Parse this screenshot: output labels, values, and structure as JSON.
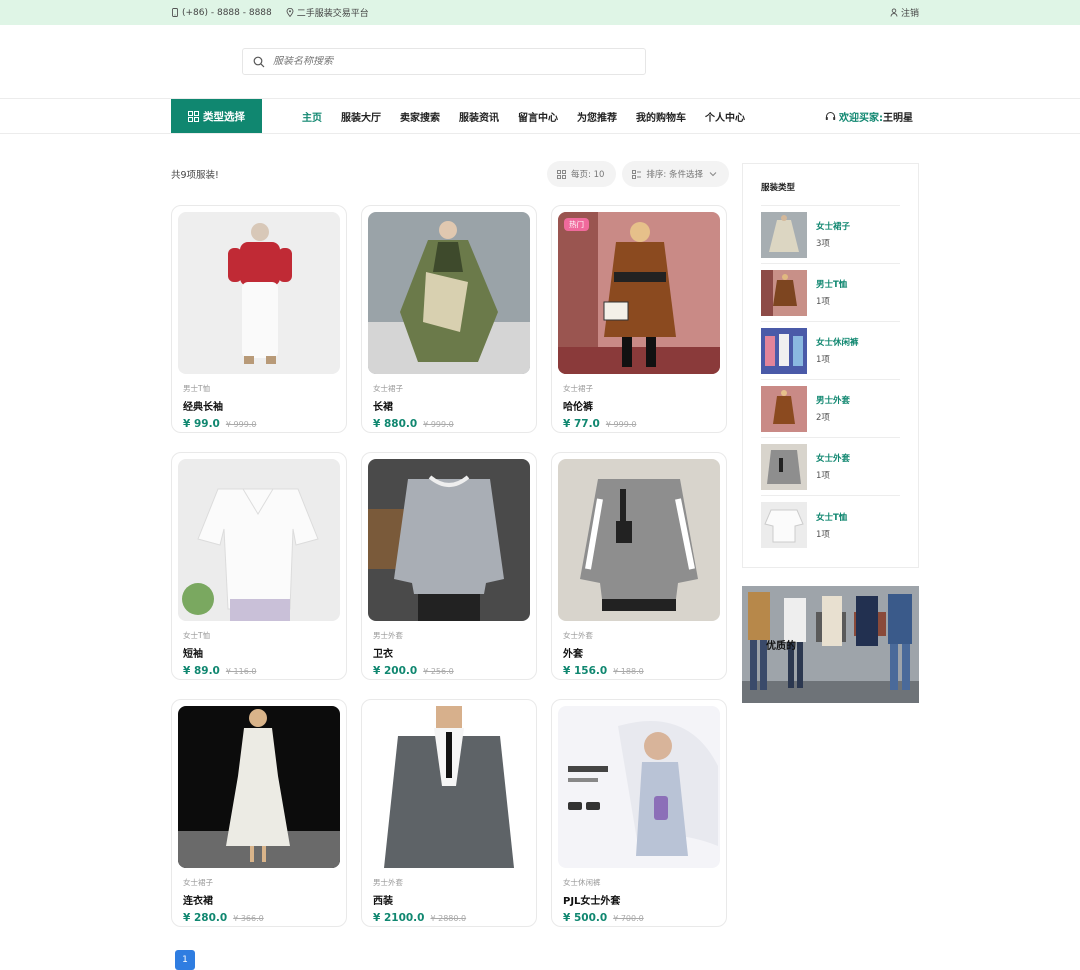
{
  "topbar": {
    "phone": "(+86) - 8888 - 8888",
    "platform": "二手服装交易平台",
    "logout": "注销"
  },
  "search": {
    "placeholder": "服装名称搜索"
  },
  "nav": {
    "category_button": "类型选择",
    "links": [
      "主页",
      "服装大厅",
      "卖家搜索",
      "服装资讯",
      "留言中心",
      "为您推荐",
      "我的购物车",
      "个人中心"
    ],
    "welcome_prefix": "欢迎买家:",
    "username": "王明星"
  },
  "list": {
    "total_text": "共9项服装!",
    "per_page": "每页: 10",
    "sort": "排序: 条件选择"
  },
  "products": [
    {
      "category": "男士T恤",
      "name": "经典长袖",
      "price": "¥ 99.0",
      "old_price": "¥ 999.0",
      "hot": ""
    },
    {
      "category": "女士裙子",
      "name": "长裙",
      "price": "¥ 880.0",
      "old_price": "¥ 999.0",
      "hot": ""
    },
    {
      "category": "女士裙子",
      "name": "哈伦裤",
      "price": "¥ 77.0",
      "old_price": "¥ 999.0",
      "hot": "热门"
    },
    {
      "category": "女士T恤",
      "name": "短袖",
      "price": "¥ 89.0",
      "old_price": "¥ 116.0",
      "hot": ""
    },
    {
      "category": "男士外套",
      "name": "卫衣",
      "price": "¥ 200.0",
      "old_price": "¥ 256.0",
      "hot": ""
    },
    {
      "category": "女士外套",
      "name": "外套",
      "price": "¥ 156.0",
      "old_price": "¥ 188.0",
      "hot": ""
    },
    {
      "category": "女士裙子",
      "name": "连衣裙",
      "price": "¥ 280.0",
      "old_price": "¥ 366.0",
      "hot": ""
    },
    {
      "category": "男士外套",
      "name": "西装",
      "price": "¥ 2100.0",
      "old_price": "¥ 2880.0",
      "hot": ""
    },
    {
      "category": "女士休闲裤",
      "name": "PJL女士外套",
      "price": "¥ 500.0",
      "old_price": "¥ 700.0",
      "hot": ""
    }
  ],
  "sidebar": {
    "title": "服装类型",
    "items": [
      {
        "name": "女士裙子",
        "count": "3项"
      },
      {
        "name": "男士T恤",
        "count": "1项"
      },
      {
        "name": "女士休闲裤",
        "count": "1项"
      },
      {
        "name": "男士外套",
        "count": "2项"
      },
      {
        "name": "女士外套",
        "count": "1项"
      },
      {
        "name": "女士T恤",
        "count": "1项"
      }
    ],
    "banner_text": "优质的"
  },
  "pagination": {
    "current": "1"
  },
  "colors": {
    "accent": "#108770",
    "topbar_bg": "#dff5e6",
    "hot_badge": "#f06a9c",
    "page_button": "#2f7de1"
  }
}
